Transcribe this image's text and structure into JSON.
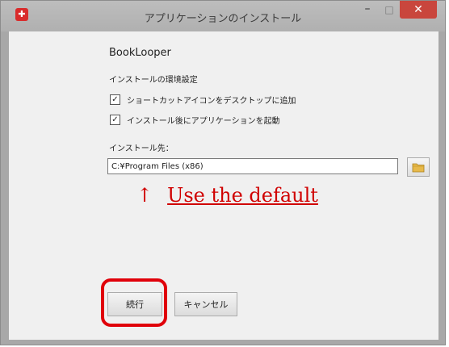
{
  "window": {
    "title": "アプリケーションのインストール",
    "app_icon_glyph": "✚",
    "minimize_glyph": "–",
    "maximize_glyph": "□",
    "close_glyph": "✕"
  },
  "content": {
    "app_name": "BookLooper",
    "settings_label": "インストールの環境設定",
    "options": [
      {
        "label": "ショートカットアイコンをデスクトップに追加",
        "checked": true
      },
      {
        "label": "インストール後にアプリケーションを起動",
        "checked": true
      }
    ],
    "destination_label": "インストール先：",
    "destination_value": "C:¥Program Files (x86)"
  },
  "annotation": {
    "arrow": "↑",
    "text": "Use the default",
    "color": "#d00000"
  },
  "buttons": {
    "continue_label": "続行",
    "cancel_label": "キャンセル"
  },
  "icons": {
    "browse": "folder-icon"
  }
}
